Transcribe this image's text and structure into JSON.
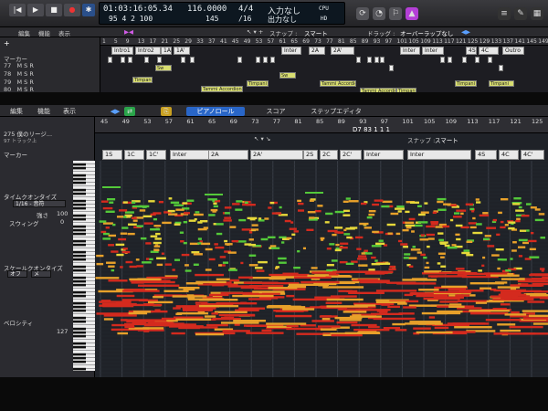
{
  "transport": {
    "time": "01:03:16:05.34",
    "bars": "95  4  2  100",
    "tempo": "116.0000",
    "tempo_sub": "145",
    "signature": "4/4",
    "division": "/16",
    "in": "入力なし",
    "out": "出力なし",
    "cpu": "CPU",
    "hd": "HD"
  },
  "arrange_toolbar": {
    "edit": "編集",
    "function": "機能",
    "view": "表示",
    "snap_label": "スナップ :",
    "snap_value": "スマート",
    "drag_label": "ドラッグ :",
    "drag_value": "オーバーラップなし"
  },
  "tracks": {
    "marker": "マーカー",
    "rows": [
      {
        "num": "77",
        "ms": "M  S  R"
      },
      {
        "num": "78",
        "ms": "M  S  R"
      },
      {
        "num": "79",
        "ms": "M  S  R"
      },
      {
        "num": "80",
        "ms": "M  S  R"
      }
    ]
  },
  "arrange_ruler": [
    "1",
    "5",
    "9",
    "13",
    "17",
    "21",
    "25",
    "29",
    "33",
    "37",
    "41",
    "45",
    "49",
    "53",
    "57",
    "61",
    "65",
    "69",
    "73",
    "77",
    "81",
    "85",
    "89",
    "93",
    "97",
    "101",
    "105",
    "109",
    "113",
    "117",
    "121",
    "125",
    "129",
    "133",
    "137",
    "141",
    "145",
    "149"
  ],
  "arrange_markers": [
    "Intro1",
    "Intro2",
    "1A",
    "1A'",
    "Inter",
    "2A",
    "2A'",
    "Inter",
    "Inter",
    "4S",
    "4C",
    "Outro"
  ],
  "regions": {
    "sw": "Sw",
    "timpani": "Timpani",
    "accordion": "Tammi Accordion"
  },
  "editor_toolbar": {
    "edit": "編集",
    "function": "機能",
    "view": "表示",
    "snap_label": "スナップ :",
    "snap_value": "スマート"
  },
  "tabs": [
    "ピアノロール",
    "スコア",
    "ステップエディタ"
  ],
  "inspector": {
    "region_name": "275 僕のリージ...",
    "track_ref": "97 トラック上",
    "marker": "マーカー",
    "time_quantize": "タイムクオンタイズ",
    "quantize_value": "1/16 - 音符",
    "strength_label": "強さ",
    "strength_value": "100",
    "swing_label": "スウィング",
    "swing_value": "0",
    "scale_quantize": "スケールクオンタイズ",
    "scale_off": "オフ",
    "scale_x": "メ",
    "velocity": "ベロシティ",
    "velocity_value": "127"
  },
  "roll_ruler": [
    "45",
    "49",
    "53",
    "57",
    "61",
    "65",
    "69",
    "73",
    "77",
    "81",
    "85",
    "89",
    "93",
    "97",
    "101",
    "105",
    "109",
    "113",
    "117",
    "121",
    "125"
  ],
  "playhead_readout": "D7  83 1 1 1",
  "roll_markers": [
    "1S",
    "1C",
    "1C'",
    "Inter",
    "2A",
    "2A'",
    "2S",
    "2C",
    "2C'",
    "Inter",
    "Inter",
    "4S",
    "4C",
    "4C'"
  ],
  "colors": {
    "accent": "#2966c8",
    "note_red": "#d42a1e",
    "note_orange": "#e8a12a",
    "note_yellow": "#e6d83a",
    "note_green": "#54c93a"
  }
}
